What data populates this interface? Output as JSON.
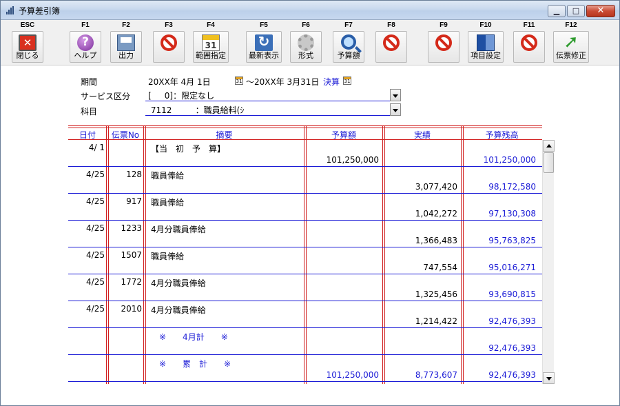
{
  "window": {
    "title": "予算差引簿"
  },
  "toolbar": {
    "keys": [
      {
        "key": "ESC",
        "label": "閉じる",
        "icon": "close-icon"
      },
      {
        "key": "F1",
        "label": "ヘルプ",
        "icon": "help-icon"
      },
      {
        "key": "F2",
        "label": "出力",
        "icon": "print-icon"
      },
      {
        "key": "F3",
        "label": "",
        "icon": "disabled-icon"
      },
      {
        "key": "F4",
        "label": "範囲指定",
        "icon": "calendar-icon"
      },
      {
        "key": "F5",
        "label": "最新表示",
        "icon": "refresh-icon"
      },
      {
        "key": "F6",
        "label": "形式",
        "icon": "gear-icon"
      },
      {
        "key": "F7",
        "label": "予算額",
        "icon": "search-icon"
      },
      {
        "key": "F8",
        "label": "",
        "icon": "disabled-icon"
      },
      {
        "key": "F9",
        "label": "",
        "icon": "disabled-icon"
      },
      {
        "key": "F10",
        "label": "項目設定",
        "icon": "book-icon"
      },
      {
        "key": "F11",
        "label": "",
        "icon": "disabled-icon"
      },
      {
        "key": "F12",
        "label": "伝票修正",
        "icon": "edit-arrow-icon"
      }
    ]
  },
  "form": {
    "period_label": "期間",
    "period_from": "20XX年 4月 1日",
    "period_to": "～20XX年 3月31日",
    "settlement_link": "決算",
    "service_label": "サービス区分",
    "service_value": "[     0]：限定なし",
    "account_label": "科目",
    "account_value": " 7112         ：職員給料(ｼ"
  },
  "table": {
    "headers": [
      "日付",
      "伝票No",
      "摘要",
      "予算額",
      "実績",
      "予算残高"
    ],
    "rows": [
      {
        "date": "4/ 1",
        "slip": "",
        "desc": "【当　初　予　算】",
        "budget": "101,250,000",
        "actual": "",
        "balance": "101,250,000"
      },
      {
        "date": "4/25",
        "slip": "128",
        "desc": "職員俸給",
        "budget": "",
        "actual": "3,077,420",
        "balance": "98,172,580"
      },
      {
        "date": "4/25",
        "slip": "917",
        "desc": "職員俸給",
        "budget": "",
        "actual": "1,042,272",
        "balance": "97,130,308"
      },
      {
        "date": "4/25",
        "slip": "1233",
        "desc": "4月分職員俸給",
        "budget": "",
        "actual": "1,366,483",
        "balance": "95,763,825"
      },
      {
        "date": "4/25",
        "slip": "1507",
        "desc": "職員俸給",
        "budget": "",
        "actual": "747,554",
        "balance": "95,016,271"
      },
      {
        "date": "4/25",
        "slip": "1772",
        "desc": "4月分職員俸給",
        "budget": "",
        "actual": "1,325,456",
        "balance": "93,690,815"
      },
      {
        "date": "4/25",
        "slip": "2010",
        "desc": "4月分職員俸給",
        "budget": "",
        "actual": "1,214,422",
        "balance": "92,476,393"
      },
      {
        "date": "",
        "slip": "",
        "desc": "　※　　4月計　　※",
        "budget": "",
        "actual": "",
        "balance": "92,476,393"
      },
      {
        "date": "",
        "slip": "",
        "desc": "　※　　累　計　　※",
        "budget": "101,250,000",
        "actual": "8,773,607",
        "balance": "92,476,393"
      }
    ]
  },
  "colors": {
    "accent_blue": "#1a1ad6",
    "grid_red": "#d12020"
  }
}
